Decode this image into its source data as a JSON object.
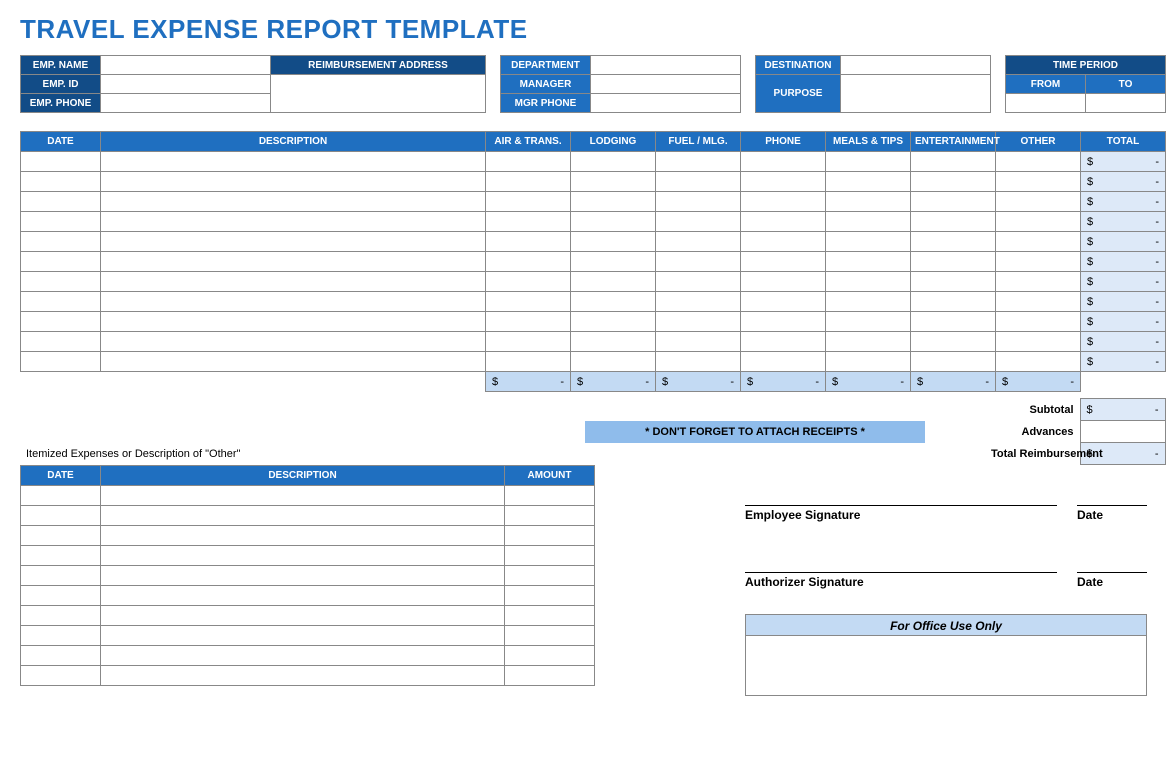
{
  "title": "TRAVEL EXPENSE REPORT TEMPLATE",
  "top": {
    "emp_name": "EMP. NAME",
    "emp_id": "EMP. ID",
    "emp_phone": "EMP. PHONE",
    "reimb_addr": "REIMBURSEMENT ADDRESS",
    "department": "DEPARTMENT",
    "manager": "MANAGER",
    "mgr_phone": "MGR PHONE",
    "destination": "DESTINATION",
    "purpose": "PURPOSE",
    "time_period": "TIME PERIOD",
    "from": "FROM",
    "to": "TO"
  },
  "exp": {
    "cols": {
      "date": "DATE",
      "desc": "DESCRIPTION",
      "air": "AIR & TRANS.",
      "lodging": "LODGING",
      "fuel": "FUEL / MLG.",
      "phone": "PHONE",
      "meals": "MEALS & TIPS",
      "ent": "ENTERTAINMENT",
      "other": "OTHER",
      "total": "TOTAL"
    },
    "row_count": 11,
    "total_placeholder_currency": "$",
    "total_placeholder_dash": "-"
  },
  "subtotals": {
    "subtotal": "Subtotal",
    "advances": "Advances",
    "total_reimb": "Total Reimbursement"
  },
  "reminder": "* DON'T FORGET TO ATTACH RECEIPTS *",
  "itemized": {
    "label": "Itemized Expenses or Description of \"Other\"",
    "cols": {
      "date": "DATE",
      "desc": "DESCRIPTION",
      "amount": "AMOUNT"
    },
    "row_count": 10
  },
  "sign": {
    "emp_sig": "Employee Signature",
    "auth_sig": "Authorizer Signature",
    "date": "Date",
    "office": "For Office Use Only"
  }
}
